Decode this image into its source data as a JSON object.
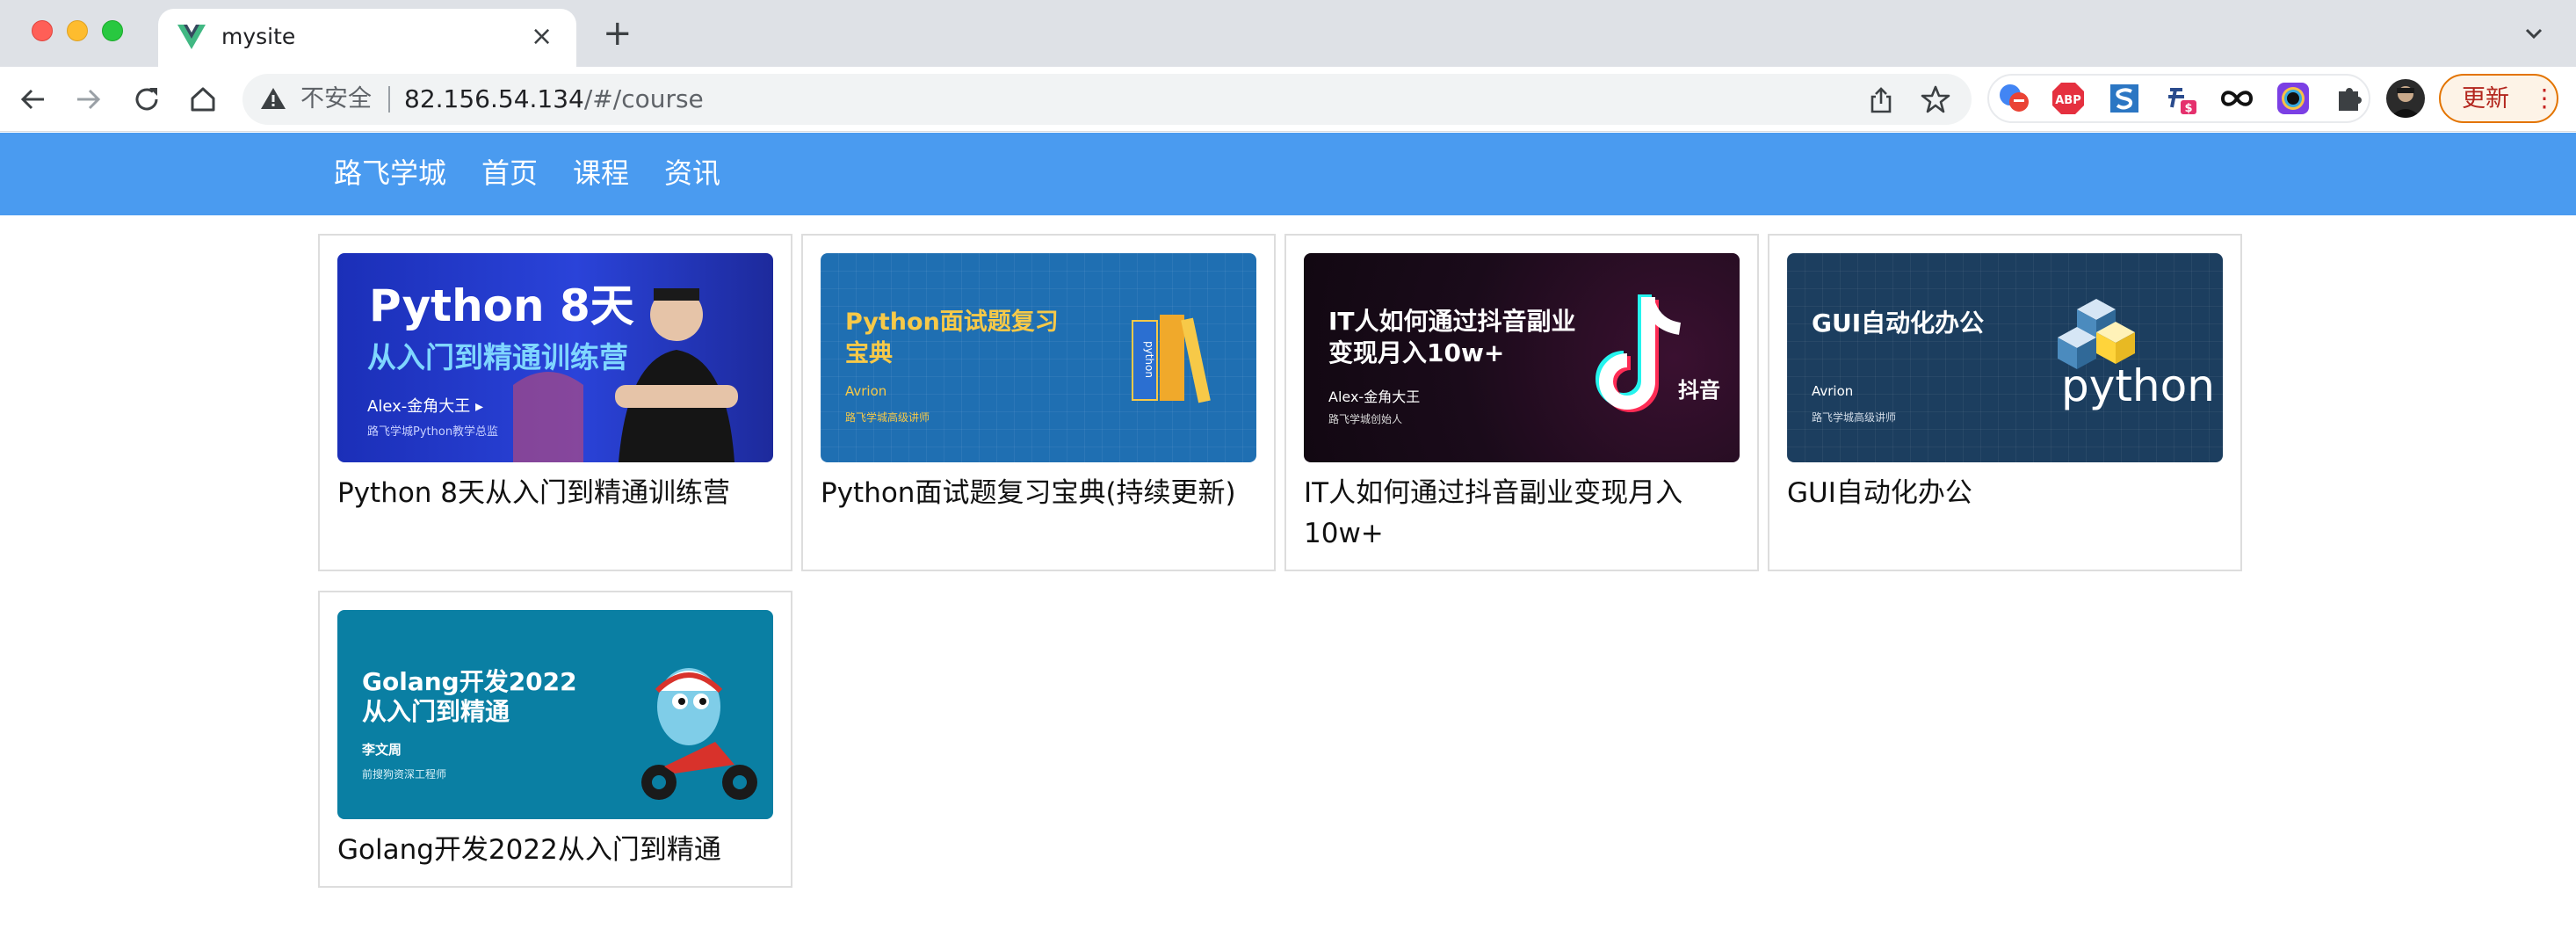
{
  "browser": {
    "tab_title": "mysite",
    "tab_close": "×",
    "new_tab": "+",
    "url_insecure_label": "不安全",
    "url_host": "82.156.54.134",
    "url_path": "/#/course",
    "update_label": "更新",
    "update_menu": "⋮",
    "extensions": [
      "translate-icon",
      "adblock-icon",
      "s-icon",
      "money-icon",
      "link-icon",
      "color-icon",
      "puzzle-icon"
    ],
    "ext_labels": {
      "adblock": "ABP"
    }
  },
  "site": {
    "brand": "路飞学城",
    "nav": [
      "首页",
      "课程",
      "资讯"
    ],
    "nav_color": "#4a9bf0"
  },
  "courses": [
    {
      "title": "Python 8天从入门到精通训练营",
      "banner": {
        "headline": "Python 8天",
        "subhead": "从入门到精通训练营",
        "teacher": "Alex-金角大王 ▸",
        "role": "路飞学城Python教学总监"
      }
    },
    {
      "title": "Python面试题复习宝典(持续更新)",
      "banner": {
        "headline": "Python面试题复习",
        "subhead": "宝典",
        "teacher": "Avrion",
        "role": "路飞学城高级讲师",
        "book_label": "python"
      }
    },
    {
      "title": "IT人如何通过抖音副业变现月入10w+",
      "banner": {
        "headline": "IT人如何通过抖音副业",
        "subhead": "变现月入10w+",
        "teacher": "Alex-金角大王",
        "role": "路飞学城创始人",
        "logo_text": "抖音"
      }
    },
    {
      "title": "GUI自动化办公",
      "banner": {
        "headline": "GUI自动化办公",
        "teacher": "Avrion",
        "role": "路飞学城高级讲师",
        "logo_text": "python"
      }
    },
    {
      "title": "Golang开发2022从入门到精通",
      "banner": {
        "headline": "Golang开发2022",
        "subhead": "从入门到精通",
        "teacher": "李文周",
        "role": "前搜狗资深工程师"
      }
    }
  ]
}
